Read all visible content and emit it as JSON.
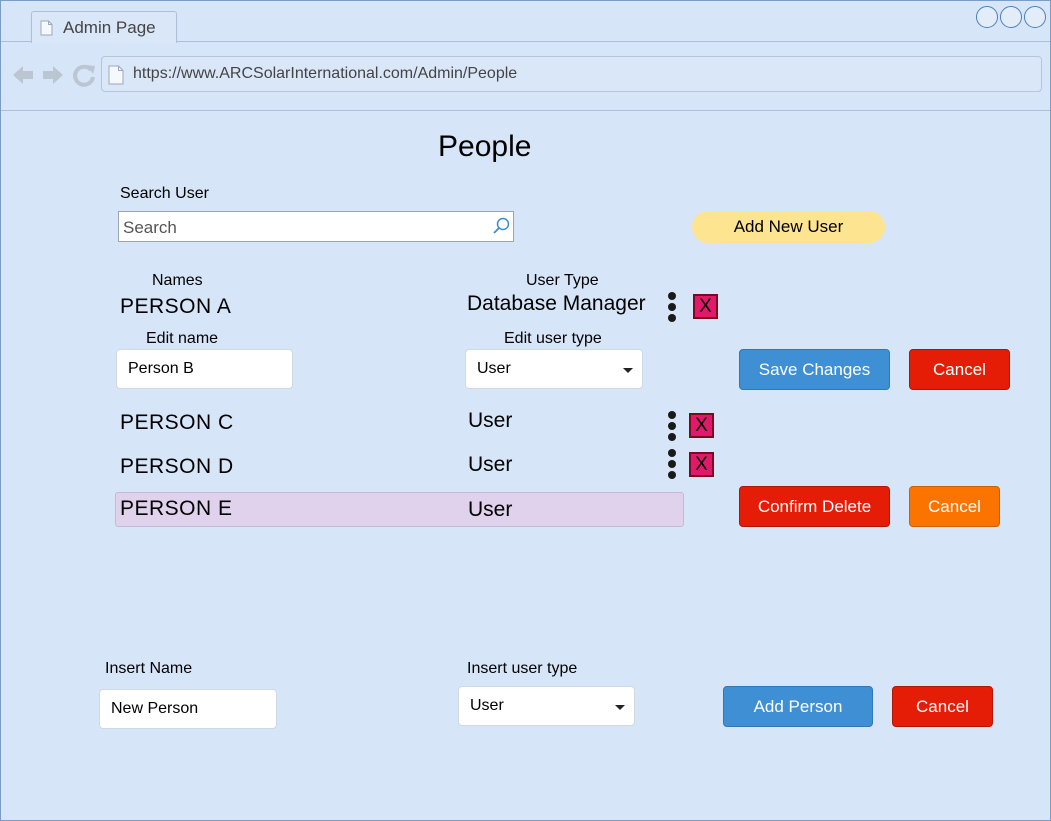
{
  "browser": {
    "tab_title": "Admin Page",
    "url": "https://www.ARCSolarInternational.com/Admin/People"
  },
  "page": {
    "title": "People"
  },
  "search": {
    "label": "Search User",
    "placeholder": "Search"
  },
  "add_new_user_label": "Add New User",
  "table": {
    "names_header": "Names",
    "user_type_header": "User Type",
    "edit_name_label": "Edit name",
    "edit_user_type_label": "Edit user type",
    "rows": [
      {
        "name": "PERSON A",
        "type": "Database Manager"
      },
      {
        "name": "PERSON C",
        "type": "User"
      },
      {
        "name": "PERSON D",
        "type": "User"
      },
      {
        "name": "PERSON E",
        "type": "User"
      }
    ],
    "delete_mark": "X"
  },
  "edit": {
    "name_value": "Person B",
    "type_value": "User",
    "save_label": "Save Changes",
    "cancel_label": "Cancel"
  },
  "delete_confirm": {
    "confirm_label": "Confirm Delete",
    "cancel_label": "Cancel"
  },
  "insert": {
    "name_label": "Insert Name",
    "name_value": "New Person",
    "type_label": "Insert user type",
    "type_value": "User",
    "add_label": "Add Person",
    "cancel_label": "Cancel"
  },
  "colors": {
    "background": "#d6e5f8",
    "add_user_button": "#fde491",
    "primary_button": "#3f8fd4",
    "danger_button": "#e61d06",
    "warning_button": "#fb7400",
    "delete_box": "#e2196a",
    "selected_row": "#e0d1ec"
  }
}
